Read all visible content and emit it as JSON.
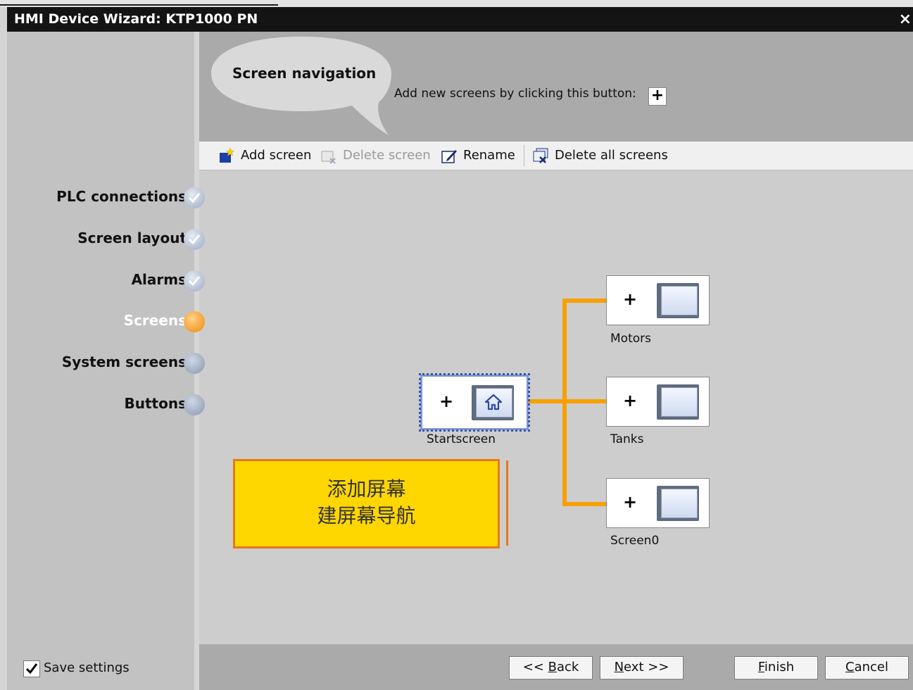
{
  "window": {
    "title": "HMI Device Wizard: KTP1000 PN",
    "close_glyph": "×"
  },
  "header": {
    "bubble_title": "Screen navigation",
    "hint": "Add new screens by clicking this button:",
    "hint_button_glyph": "+"
  },
  "toolbar": {
    "add_screen": "Add screen",
    "delete_screen": "Delete screen",
    "rename": "Rename",
    "delete_all": "Delete all screens"
  },
  "steps": [
    {
      "label": "PLC connections",
      "state": "done"
    },
    {
      "label": "Screen layout",
      "state": "done"
    },
    {
      "label": "Alarms",
      "state": "done"
    },
    {
      "label": "Screens",
      "state": "current"
    },
    {
      "label": "System screens",
      "state": "todo"
    },
    {
      "label": "Buttons",
      "state": "todo"
    }
  ],
  "screens": {
    "start": "Startscreen",
    "children": [
      "Motors",
      "Tanks",
      "Screen0"
    ],
    "plus_glyph": "+"
  },
  "note": {
    "line1": "添加屏幕",
    "line2": "建屏幕导航"
  },
  "footer": {
    "save_settings": "Save settings",
    "save_checked": true,
    "back_prefix": "<< ",
    "back_mnemonic": "B",
    "back_rest": "ack",
    "next_mnemonic": "N",
    "next_rest": "ext >>",
    "finish_mnemonic": "F",
    "finish_rest": "inish",
    "cancel_mnemonic": "C",
    "cancel_rest": "ancel"
  },
  "colors": {
    "connector": "#f7a000",
    "note_fill": "#fed600",
    "note_border": "#e8781e",
    "active_step": "#f08a00"
  }
}
